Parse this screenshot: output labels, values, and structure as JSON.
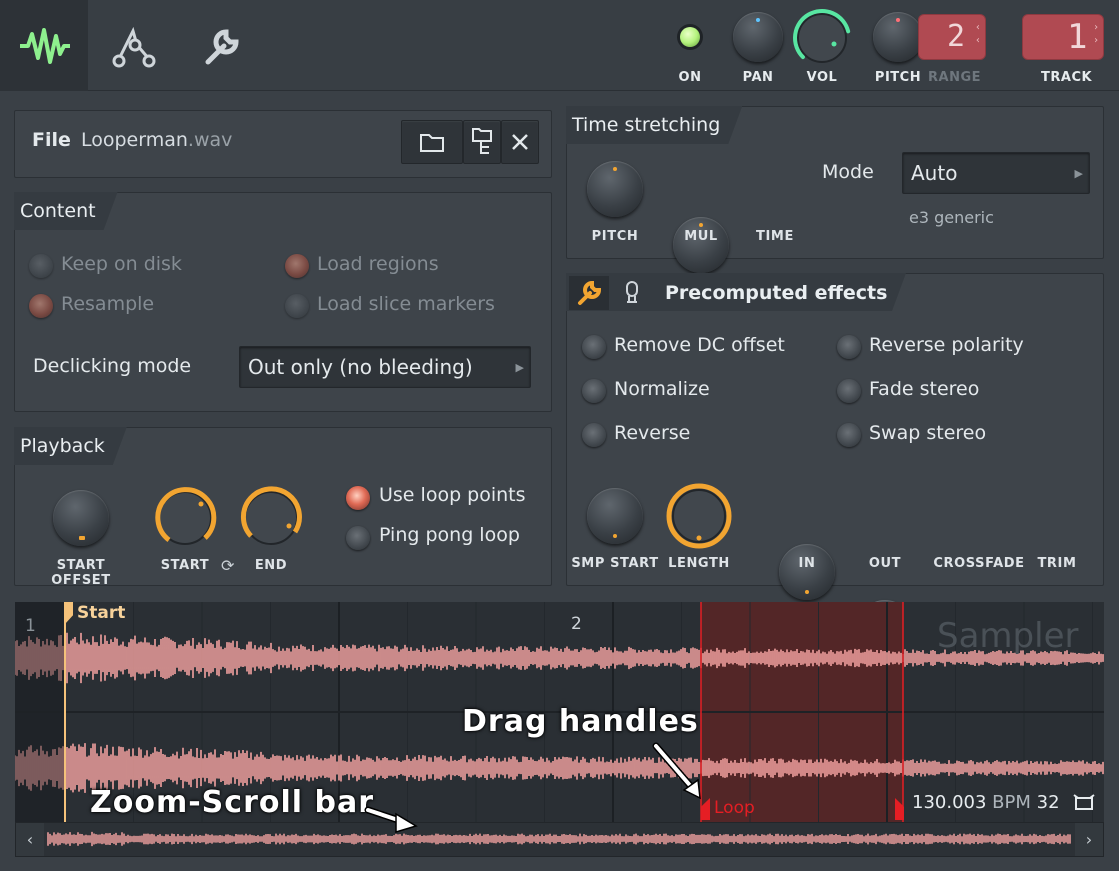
{
  "topbar": {
    "tabs": [
      {
        "name": "tab-sample-settings",
        "icon": "waveform-icon"
      },
      {
        "name": "tab-envelope",
        "icon": "envelope-icon"
      },
      {
        "name": "tab-misc",
        "icon": "wrench-icon"
      }
    ],
    "on_label": "ON",
    "pan_label": "PAN",
    "vol_label": "VOL",
    "pitch_label": "PITCH",
    "range_label": "RANGE",
    "range_value": "2",
    "track_label": "TRACK",
    "track_value": "1",
    "vol_level": 0.78
  },
  "file": {
    "label": "File",
    "name": "Looperman",
    "ext": ".wav"
  },
  "content": {
    "title": "Content",
    "options": [
      {
        "label": "Keep on disk",
        "checked": false
      },
      {
        "label": "Load regions",
        "checked": true
      },
      {
        "label": "Resample",
        "checked": true
      },
      {
        "label": "Load slice markers",
        "checked": false
      }
    ],
    "declicking_label": "Declicking mode",
    "declicking_value": "Out only (no bleeding)"
  },
  "playback": {
    "title": "Playback",
    "start_offset_label": "START OFFSET",
    "start_label": "START",
    "end_label": "END",
    "use_loop_points": "Use loop points",
    "ping_pong_loop": "Ping pong loop"
  },
  "time_stretching": {
    "title": "Time stretching",
    "pitch_label": "PITCH",
    "mul_label": "MUL",
    "time_label": "TIME",
    "mode_label": "Mode",
    "mode_value": "Auto",
    "mode_sub": "e3 generic"
  },
  "precomputed": {
    "title": "Precomputed effects",
    "effects": [
      "Remove DC offset",
      "Reverse polarity",
      "Normalize",
      "Fade stereo",
      "Reverse",
      "Swap stereo"
    ],
    "knobs": [
      "SMP START",
      "LENGTH",
      "IN",
      "OUT",
      "CROSSFADE",
      "TRIM"
    ]
  },
  "waveform": {
    "bar1": "1",
    "bar2": "2",
    "start_marker": "Start",
    "loop_marker": "Loop",
    "watermark": "Sampler",
    "bpm": "130.003",
    "bpm_unit": "BPM",
    "beats": "32"
  },
  "annotations": {
    "drag_handles": "Drag handles",
    "zoom_scroll": "Zoom-Scroll bar"
  },
  "colors": {
    "accent_orange": "#f2a531",
    "loop_red": "#e51e24",
    "vol_green": "#58e6a2",
    "on_led": "#b4f27d"
  }
}
